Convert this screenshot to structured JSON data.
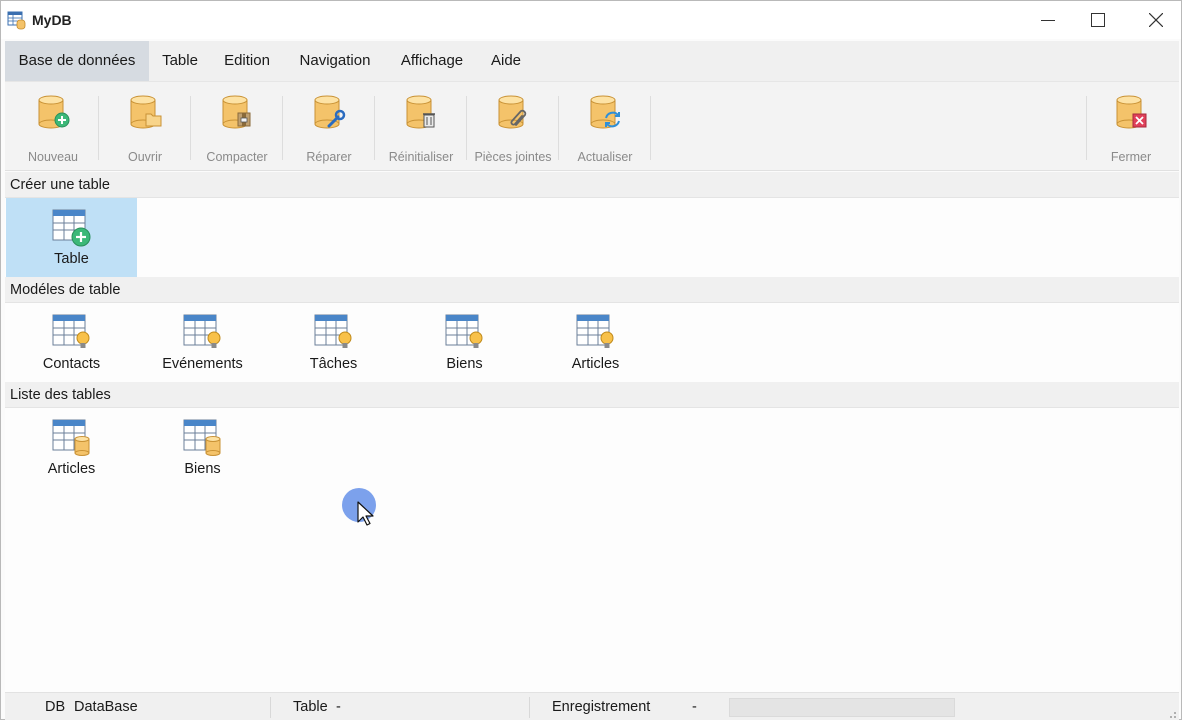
{
  "window": {
    "title": "MyDB"
  },
  "menu": {
    "items": [
      "Base de données",
      "Table",
      "Edition",
      "Navigation",
      "Affichage",
      "Aide"
    ],
    "active_index": 0
  },
  "toolbar": {
    "buttons": [
      {
        "label": "Nouveau",
        "icon": "db-new-icon",
        "enabled": true
      },
      {
        "label": "Ouvrir",
        "icon": "db-open-icon",
        "enabled": false
      },
      {
        "label": "Compacter",
        "icon": "db-compact-icon",
        "enabled": false
      },
      {
        "label": "Réparer",
        "icon": "db-repair-icon",
        "enabled": false
      },
      {
        "label": "Réinitialiser",
        "icon": "db-reset-icon",
        "enabled": false
      },
      {
        "label": "Pièces jointes",
        "icon": "db-attachments-icon",
        "enabled": false
      },
      {
        "label": "Actualiser",
        "icon": "db-refresh-icon",
        "enabled": false
      },
      {
        "label": "Fermer",
        "icon": "db-close-icon",
        "enabled": false
      }
    ]
  },
  "sections": {
    "create": {
      "title": "Créer une table",
      "items": [
        {
          "label": "Table",
          "icon": "table-add-icon"
        }
      ]
    },
    "templates": {
      "title": "Modéles de table",
      "items": [
        {
          "label": "Contacts",
          "icon": "table-template-icon"
        },
        {
          "label": "Evénements",
          "icon": "table-template-icon"
        },
        {
          "label": "Tâches",
          "icon": "table-template-icon"
        },
        {
          "label": "Biens",
          "icon": "table-template-icon"
        },
        {
          "label": "Articles",
          "icon": "table-template-icon"
        }
      ]
    },
    "tables": {
      "title": "Liste des tables",
      "items": [
        {
          "label": "Articles",
          "icon": "table-db-icon"
        },
        {
          "label": "Biens",
          "icon": "table-db-icon"
        }
      ]
    }
  },
  "status": {
    "db_prefix": "DB",
    "db_name": "DataBase",
    "table_label": "Table",
    "table_value": "-",
    "record_label": "Enregistrement",
    "record_value": "-"
  },
  "colors": {
    "accent_selected": "#bfe0f6",
    "db_cylinder": "#f4c36a",
    "table_header": "#4a86c8",
    "add_green": "#3cb878",
    "close_red": "#e0405a"
  }
}
